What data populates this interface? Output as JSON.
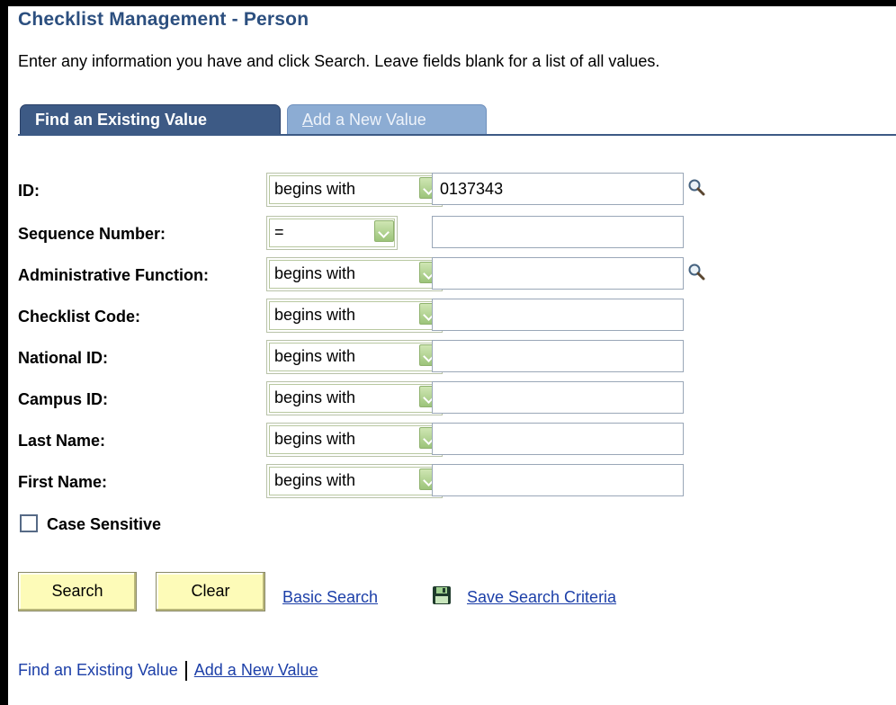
{
  "page": {
    "title": "Checklist Management - Person",
    "instructions": "Enter any information you have and click Search. Leave fields blank for a list of all values."
  },
  "tabs": [
    {
      "label": "Find an Existing Value",
      "active": true
    },
    {
      "label_access_key": "A",
      "label_rest": "dd a New Value",
      "active": false
    }
  ],
  "fields": [
    {
      "label": "ID:",
      "operator": "begins with",
      "value": "0137343",
      "lookup": true
    },
    {
      "label": "Sequence Number:",
      "operator": "=",
      "value": "",
      "lookup": false
    },
    {
      "label": "Administrative Function:",
      "operator": "begins with",
      "value": "",
      "lookup": true
    },
    {
      "label": "Checklist Code:",
      "operator": "begins with",
      "value": "",
      "lookup": false
    },
    {
      "label": "National ID:",
      "operator": "begins with",
      "value": "",
      "lookup": false
    },
    {
      "label": "Campus ID:",
      "operator": "begins with",
      "value": "",
      "lookup": false
    },
    {
      "label": "Last Name:",
      "operator": "begins with",
      "value": "",
      "lookup": false
    },
    {
      "label": "First Name:",
      "operator": "begins with",
      "value": "",
      "lookup": false
    }
  ],
  "case_sensitive": {
    "label": "Case Sensitive",
    "checked": false
  },
  "actions": {
    "search_label": "Search",
    "clear_label": "Clear",
    "basic_search_label": "Basic Search",
    "save_search_label": "Save Search Criteria"
  },
  "footer": {
    "find_label": "Find an Existing Value",
    "add_label": "Add a New Value"
  },
  "colors": {
    "title": "#2c4f7f",
    "tab_active": "#3d5a85",
    "tab_inactive": "#8cacd3",
    "button_bg": "#fdfbb8",
    "link": "#1c3fa8",
    "dropdown_button": "#9cc47a"
  },
  "icons": {
    "lookup": "magnifier-icon",
    "save": "floppy-disk-icon",
    "dropdown": "chevron-down-icon"
  }
}
